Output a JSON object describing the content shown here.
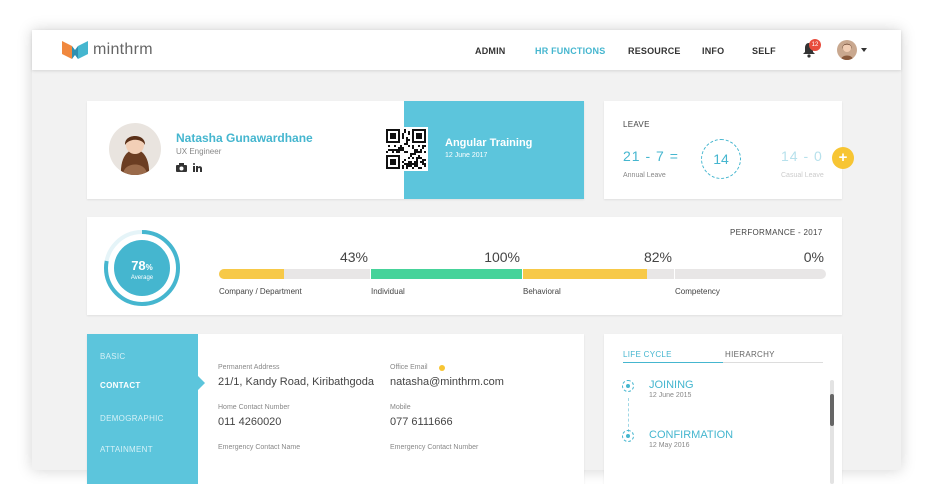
{
  "brand": {
    "name": "minthrm"
  },
  "nav": {
    "items": [
      "ADMIN",
      "HR FUNCTIONS",
      "RESOURCE",
      "INFO",
      "SELF"
    ],
    "active": "HR FUNCTIONS"
  },
  "notifications": {
    "count": "12",
    "icon": "bell-icon"
  },
  "profile": {
    "name": "Natasha Gunawardhane",
    "title": "UX Engineer",
    "icons": [
      "camera-icon",
      "linkedin-icon"
    ]
  },
  "training": {
    "title": "Angular Training",
    "date": "12 June 2017"
  },
  "leave": {
    "title": "LEAVE",
    "annual_calc": "21 - 7  =",
    "annual_result": "14",
    "annual_label": "Annual Leave",
    "casual_calc": "14 - 0",
    "casual_label": "Casual Leave"
  },
  "performance": {
    "title": "PERFORMANCE  - 2017",
    "average_value": "78",
    "average_unit": "%",
    "average_fraction": 0.78,
    "average_label": "Average",
    "segments": [
      {
        "label": "Company / Department",
        "percent": "43%",
        "fill": 0.43,
        "color": "#f7c948"
      },
      {
        "label": "Individual",
        "percent": "100%",
        "fill": 1.0,
        "color": "#46d39a"
      },
      {
        "label": "Behavioral",
        "percent": "82%",
        "fill": 0.82,
        "color": "#f7c948"
      },
      {
        "label": "Competency",
        "percent": "0%",
        "fill": 0.0,
        "color": "#f7c948"
      }
    ],
    "track_color": "#e8e6e6"
  },
  "details": {
    "sidebar": [
      "BASIC",
      "CONTACT",
      "DEMOGRAPHIC",
      "ATTAINMENT"
    ],
    "active_tab": "CONTACT",
    "fields": {
      "permanent_address_label": "Permanent Address",
      "permanent_address": "21/1, Kandy Road, Kiribathgoda",
      "office_email_label": "Office Email",
      "office_email": "natasha@minthrm.com",
      "home_contact_label": "Home Contact Number",
      "home_contact": "011 4260020",
      "mobile_label": "Mobile",
      "mobile": "077 6111666",
      "emergency_name_label": "Emergency Contact Name",
      "emergency_number_label": "Emergency Contact Number"
    }
  },
  "lifecycle": {
    "tabs": [
      "LIFE CYCLE",
      "HIERARCHY"
    ],
    "events": [
      {
        "title": "JOINING",
        "date": "12 June 2015"
      },
      {
        "title": "CONFIRMATION",
        "date": "12 May 2016"
      }
    ]
  },
  "colors": {
    "accent": "#45b6cf",
    "panel": "#5cc5dc",
    "yellow": "#f7c533",
    "badge": "#e84c3d"
  }
}
